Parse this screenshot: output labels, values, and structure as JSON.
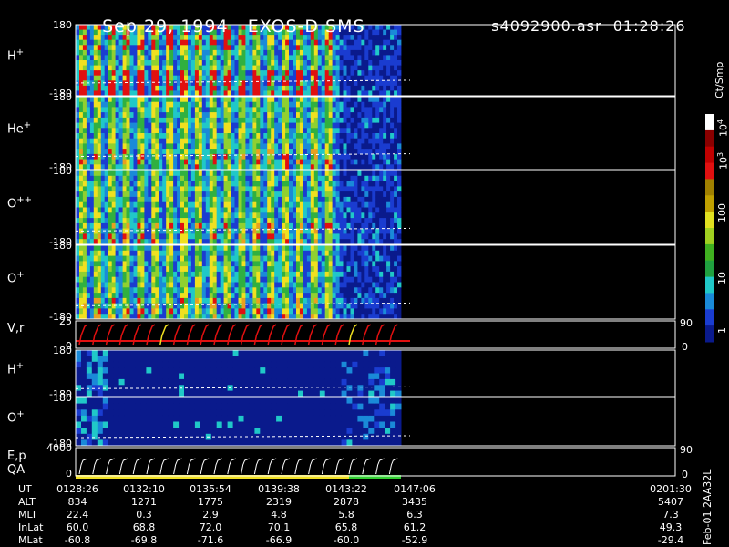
{
  "header": {
    "date": "Sep 29, 1994",
    "instrument": "EXOS-D SMS",
    "file": "s4092900.asr",
    "time": "01:28:26"
  },
  "panels": [
    {
      "label_main": "H",
      "label_sup": "+",
      "top": "180",
      "bottom": "-180"
    },
    {
      "label_main": "He",
      "label_sup": "+",
      "top": "180",
      "bottom": "-180"
    },
    {
      "label_main": "O",
      "label_sup": "++",
      "top": "180",
      "bottom": "-180"
    },
    {
      "label_main": "O",
      "label_sup": "+",
      "top": "180",
      "bottom": "-180"
    },
    {
      "label_main": "V,r",
      "label_sup": "",
      "top": "25",
      "bottom": "0",
      "right_top": "90",
      "right_bottom": "0"
    },
    {
      "label_main": "H",
      "label_sup": "+",
      "top": "180",
      "bottom": "-180"
    },
    {
      "label_main": "O",
      "label_sup": "+",
      "top": "180",
      "bottom": "-180"
    },
    {
      "label_main": "E,p",
      "label_sup": "",
      "label_extra": "QA",
      "top": "4000",
      "bottom": "0",
      "right_top": "90",
      "right_bottom": "0"
    }
  ],
  "colorbar": {
    "unit": "Ct/Smp",
    "ticks": [
      "1",
      "10",
      "100",
      "10",
      "10"
    ],
    "tick_sup": [
      "",
      "",
      "",
      "3",
      "4"
    ]
  },
  "footer": {
    "rows": [
      {
        "name": "UT",
        "values": [
          "0128:26",
          "0132:10",
          "0135:54",
          "0139:38",
          "0143:22",
          "0147:06",
          "0201:30"
        ]
      },
      {
        "name": "ALT",
        "values": [
          "834",
          "1271",
          "1775",
          "2319",
          "2878",
          "3435",
          "5407"
        ]
      },
      {
        "name": "MLT",
        "values": [
          "22.4",
          "0.3",
          "2.9",
          "4.8",
          "5.8",
          "6.3",
          "7.3"
        ]
      },
      {
        "name": "InLat",
        "values": [
          "60.0",
          "68.8",
          "72.0",
          "70.1",
          "65.8",
          "61.2",
          "49.3"
        ]
      },
      {
        "name": "MLat",
        "values": [
          "-60.8",
          "-69.8",
          "-71.6",
          "-66.9",
          "-60.0",
          "-52.9",
          "-29.4"
        ]
      }
    ],
    "stamp": "Feb-01 2AA32L"
  },
  "chart_data": {
    "type": "heatmap",
    "title": "Sep 29, 1994   EXOS-D SMS",
    "x_axis": {
      "label": "UT",
      "ticks": [
        "0128:26",
        "0132:10",
        "0135:54",
        "0139:38",
        "0143:22",
        "0147:06",
        "0201:30"
      ]
    },
    "y_range": [
      -180,
      180
    ],
    "colorbar": {
      "unit": "Ct/Smp",
      "scale": "log",
      "range": [
        1,
        10000
      ]
    },
    "series": [
      {
        "name": "H+",
        "data_end_x": "0147:06"
      },
      {
        "name": "He+",
        "data_end_x": "0147:06"
      },
      {
        "name": "O++",
        "data_end_x": "0147:06"
      },
      {
        "name": "O+",
        "data_end_x": "0147:06"
      },
      {
        "name": "V,r",
        "range": [
          0,
          25
        ]
      },
      {
        "name": "H+ (lower)",
        "data_end_x": "0147:06"
      },
      {
        "name": "O+ (lower)",
        "data_end_x": "0147:06"
      },
      {
        "name": "E,p",
        "range": [
          0,
          4000
        ]
      }
    ],
    "colors": {
      "low": "#0a1a8c",
      "mid": "#f0e020",
      "high": "#e01010",
      "frame": "#ffffff"
    }
  }
}
